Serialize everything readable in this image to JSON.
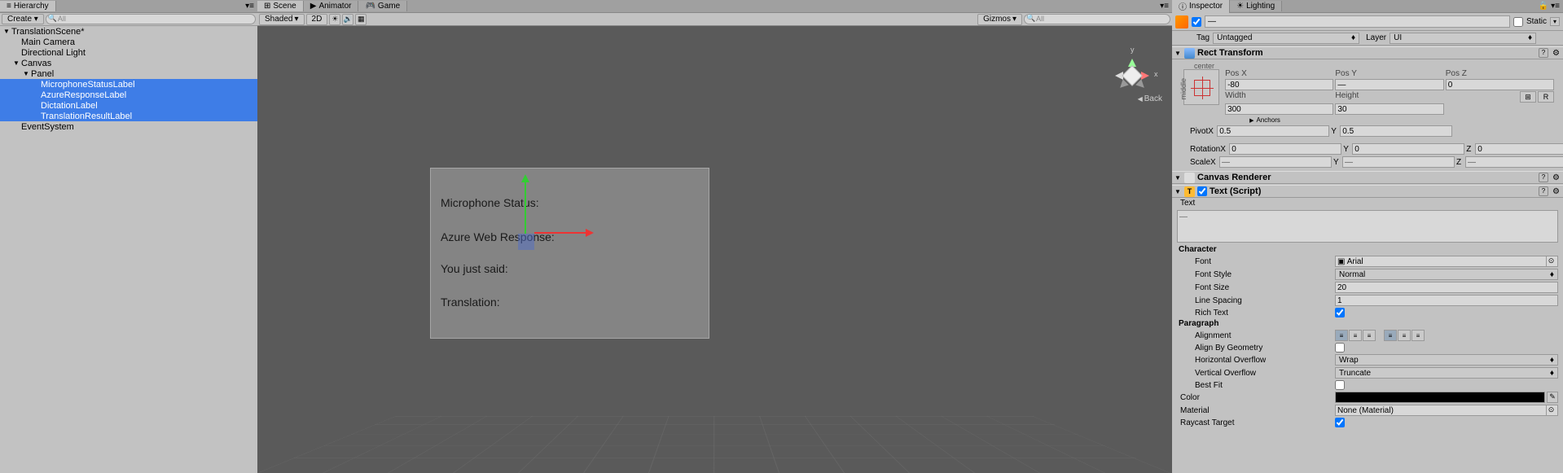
{
  "hierarchy": {
    "tab": "Hierarchy",
    "create": "Create",
    "searchPlaceholder": "All",
    "scene": "TranslationScene*",
    "items": {
      "mainCamera": "Main Camera",
      "directionalLight": "Directional Light",
      "canvas": "Canvas",
      "panel": "Panel",
      "micLabel": "MicrophoneStatusLabel",
      "azureLabel": "AzureResponseLabel",
      "dictationLabel": "DictationLabel",
      "translationLabel": "TranslationResultLabel",
      "eventSystem": "EventSystem"
    }
  },
  "scene": {
    "tabs": {
      "scene": "Scene",
      "animator": "Animator",
      "game": "Game"
    },
    "toolbar": {
      "shaded": "Shaded",
      "twoD": "2D",
      "gizmos": "Gizmos",
      "searchPlaceholder": "All"
    },
    "nav": {
      "back": "Back",
      "y": "y",
      "x": "x"
    },
    "panel": {
      "mic": "Microphone Status:",
      "azure": "Azure Web Response:",
      "said": "You just said:",
      "translation": "Translation:"
    }
  },
  "inspector": {
    "tabs": {
      "inspector": "Inspector",
      "lighting": "Lighting"
    },
    "nameDash": "—",
    "static": "Static",
    "tag": {
      "label": "Tag",
      "value": "Untagged"
    },
    "layer": {
      "label": "Layer",
      "value": "UI"
    },
    "rect": {
      "title": "Rect Transform",
      "anchorCenter": "center",
      "anchorMiddle": "middle",
      "posX": {
        "label": "Pos X",
        "value": "-80"
      },
      "posY": {
        "label": "Pos Y",
        "value": "—"
      },
      "posZ": {
        "label": "Pos Z",
        "value": "0"
      },
      "width": {
        "label": "Width",
        "value": "300"
      },
      "height": {
        "label": "Height",
        "value": "30"
      },
      "anchors": "Anchors",
      "pivot": {
        "label": "Pivot",
        "x": "0.5",
        "y": "0.5"
      },
      "rotation": {
        "label": "Rotation",
        "x": "0",
        "y": "0",
        "z": "0"
      },
      "scale": {
        "label": "Scale",
        "x": "—",
        "y": "—",
        "z": "—"
      },
      "blueprintBtn": "⊞",
      "rawBtn": "R"
    },
    "canvasRenderer": {
      "title": "Canvas Renderer"
    },
    "text": {
      "title": "Text (Script)",
      "textLabel": "Text",
      "textValue": "—",
      "character": "Character",
      "font": {
        "label": "Font",
        "value": "Arial"
      },
      "fontStyle": {
        "label": "Font Style",
        "value": "Normal"
      },
      "fontSize": {
        "label": "Font Size",
        "value": "20"
      },
      "lineSpacing": {
        "label": "Line Spacing",
        "value": "1"
      },
      "richText": "Rich Text",
      "paragraph": "Paragraph",
      "alignment": "Alignment",
      "alignByGeometry": "Align By Geometry",
      "hOverflow": {
        "label": "Horizontal Overflow",
        "value": "Wrap"
      },
      "vOverflow": {
        "label": "Vertical Overflow",
        "value": "Truncate"
      },
      "bestFit": "Best Fit",
      "color": "Color",
      "material": {
        "label": "Material",
        "value": "None (Material)"
      },
      "raycastTarget": "Raycast Target"
    }
  }
}
